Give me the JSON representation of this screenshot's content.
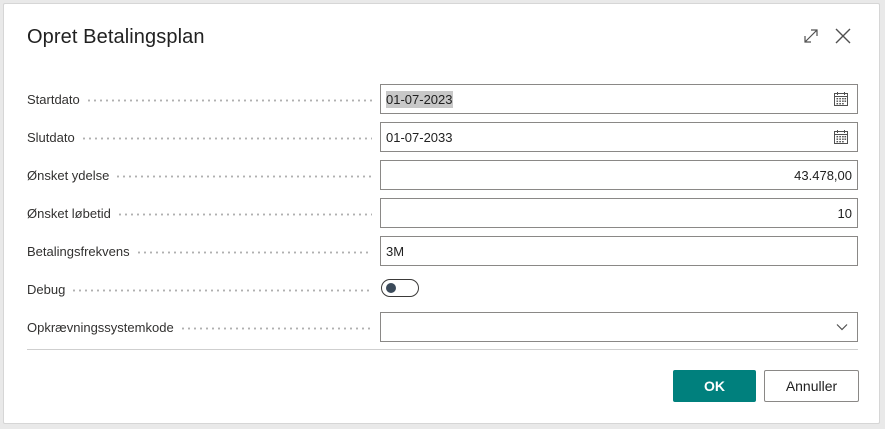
{
  "dialog": {
    "title": "Opret Betalingsplan",
    "icons": {
      "expand": "expand-icon",
      "close": "close-icon"
    }
  },
  "fields": {
    "startdato": {
      "label": "Startdato",
      "value": "01-07-2023",
      "icon": "calendar-icon"
    },
    "slutdato": {
      "label": "Slutdato",
      "value": "01-07-2033",
      "icon": "calendar-icon"
    },
    "oensket_ydelse": {
      "label": "Ønsket ydelse",
      "value": "43.478,00"
    },
    "oensket_loebetid": {
      "label": "Ønsket løbetid",
      "value": "10"
    },
    "betalingsfrekvens": {
      "label": "Betalingsfrekvens",
      "value": "3M"
    },
    "debug": {
      "label": "Debug",
      "on": false
    },
    "opkraevningssystemkode": {
      "label": "Opkrævningssystemkode",
      "value": "",
      "icon": "chevron-down-icon"
    }
  },
  "buttons": {
    "ok": "OK",
    "cancel": "Annuller"
  },
  "colors": {
    "primary": "#00807d",
    "border": "#8a8886"
  }
}
